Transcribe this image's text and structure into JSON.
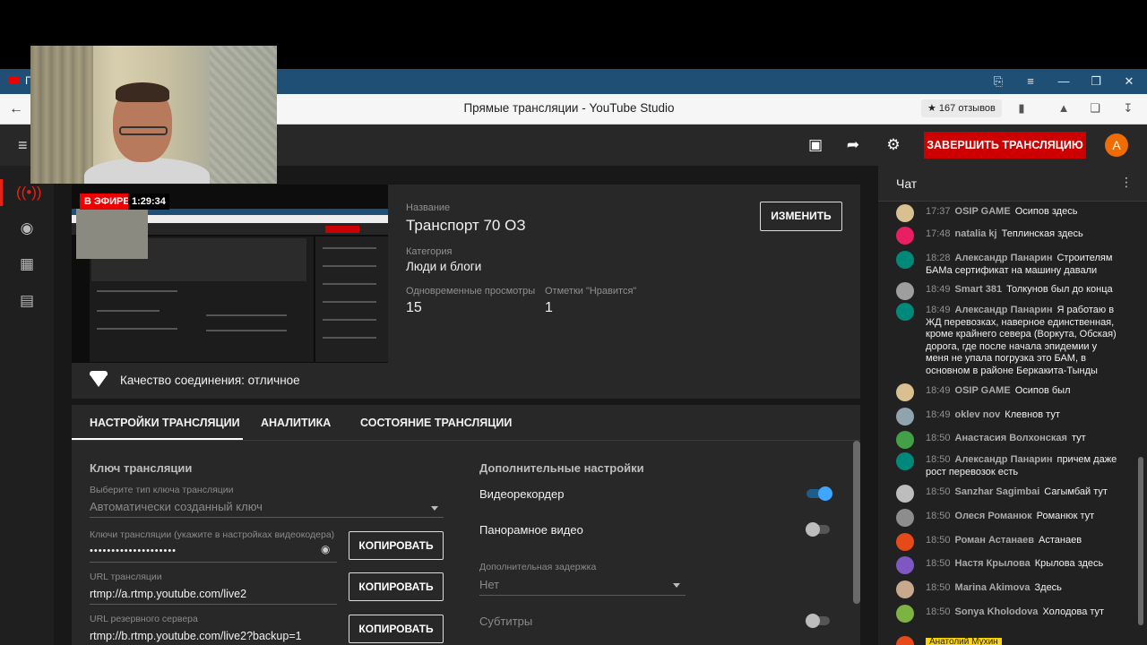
{
  "browser": {
    "tab_title": "П",
    "page_title": "Прямые трансляции - YouTube Studio",
    "reviews_badge": "★ 167 отзывов",
    "window_controls": [
      "⎘",
      "≡",
      "—",
      "❐",
      "✕"
    ]
  },
  "header": {
    "end_stream_label": "ЗАВЕРШИТЬ ТРАНСЛЯЦИЮ",
    "avatar_letter": "А"
  },
  "stream": {
    "live_badge": "В ЭФИРЕ",
    "live_time": "1:29:34",
    "title_label": "Название",
    "title_value": "Транспорт 70 ОЗ",
    "category_label": "Категория",
    "category_value": "Люди и блоги",
    "viewers_label": "Одновременные просмотры",
    "viewers_value": "15",
    "likes_label": "Отметки \"Нравится\"",
    "likes_value": "1",
    "edit_label": "ИЗМЕНИТЬ",
    "connection_text": "Качество соединения: отличное"
  },
  "tabs": [
    {
      "label": "НАСТРОЙКИ ТРАНСЛЯЦИИ"
    },
    {
      "label": "АНАЛИТИКА"
    },
    {
      "label": "СОСТОЯНИЕ ТРАНСЛЯЦИИ"
    }
  ],
  "settings": {
    "key_section_title": "Ключ трансляции",
    "key_type_label": "Выберите тип ключа трансляции",
    "key_type_value": "Автоматически созданный ключ",
    "key_label": "Ключи трансляции (укажите в настройках видеокодера)",
    "key_value": "••••••••••••••••••••",
    "url_label": "URL трансляции",
    "url_value": "rtmp://a.rtmp.youtube.com/live2",
    "backup_label": "URL резервного сервера",
    "backup_value": "rtmp://b.rtmp.youtube.com/live2?backup=1",
    "copy_label": "КОПИРОВАТЬ",
    "extra_title": "Дополнительные настройки",
    "dvr_label": "Видеорекордер",
    "dvr_on": true,
    "pano_label": "Панорамное видео",
    "pano_on": false,
    "delay_label": "Дополнительная задержка",
    "delay_value": "Нет",
    "subs_label": "Субтитры",
    "subs_on": false,
    "accent_color": "#3ea6ff"
  },
  "chat": {
    "title": "Чат",
    "messages": [
      {
        "time": "17:37",
        "author": "OSIP GAME",
        "text": "Осипов здесь",
        "color": "#d8c090"
      },
      {
        "time": "17:48",
        "author": "natalia kj",
        "text": "Теплинская здесь",
        "color": "#e91e63"
      },
      {
        "time": "18:28",
        "author": "Александр Панарин",
        "text": "Строителям БАМа сертификат на машину давали",
        "color": "#00897b"
      },
      {
        "time": "18:49",
        "author": "Smart 381",
        "text": "Толкунов был до конца",
        "color": "#9e9e9e"
      },
      {
        "time": "18:49",
        "author": "Александр Панарин",
        "text": "Я работаю в ЖД перевозках, наверное единственная, кроме крайнего севера (Воркута, Обская) дорога, где после начала эпидемии у меня не упала погрузка это БАМ, в основном в районе Беркакита-Тынды",
        "color": "#00897b"
      },
      {
        "time": "18:49",
        "author": "OSIP GAME",
        "text": "Осипов был",
        "color": "#d8c090"
      },
      {
        "time": "18:49",
        "author": "oklev nov",
        "text": "Клевнов тут",
        "color": "#90a4ae"
      },
      {
        "time": "18:50",
        "author": "Анастасия Волхонская",
        "text": "тут",
        "color": "#43a047"
      },
      {
        "time": "18:50",
        "author": "Александр Панарин",
        "text": "причем даже рост перевозок есть",
        "color": "#00897b"
      },
      {
        "time": "18:50",
        "author": "Sanzhar Sagimbai",
        "text": "Сагымбай тут",
        "color": "#bdbdbd"
      },
      {
        "time": "18:50",
        "author": "Олеся Романюк",
        "text": "Романюк тут",
        "color": "#8d8d8d"
      },
      {
        "time": "18:50",
        "author": "Роман Астанаев",
        "text": "Астанаев",
        "color": "#e64a19"
      },
      {
        "time": "18:50",
        "author": "Настя Крылова",
        "text": "Крылова здесь",
        "color": "#7e57c2"
      },
      {
        "time": "18:50",
        "author": "Marina Akimova",
        "text": "Здесь",
        "color": "#c9a98e"
      },
      {
        "time": "18:50",
        "author": "Sonya Kholodova",
        "text": "Холодова тут",
        "color": "#7cb342"
      }
    ],
    "bottom_author": "Анатолий Мухин"
  }
}
